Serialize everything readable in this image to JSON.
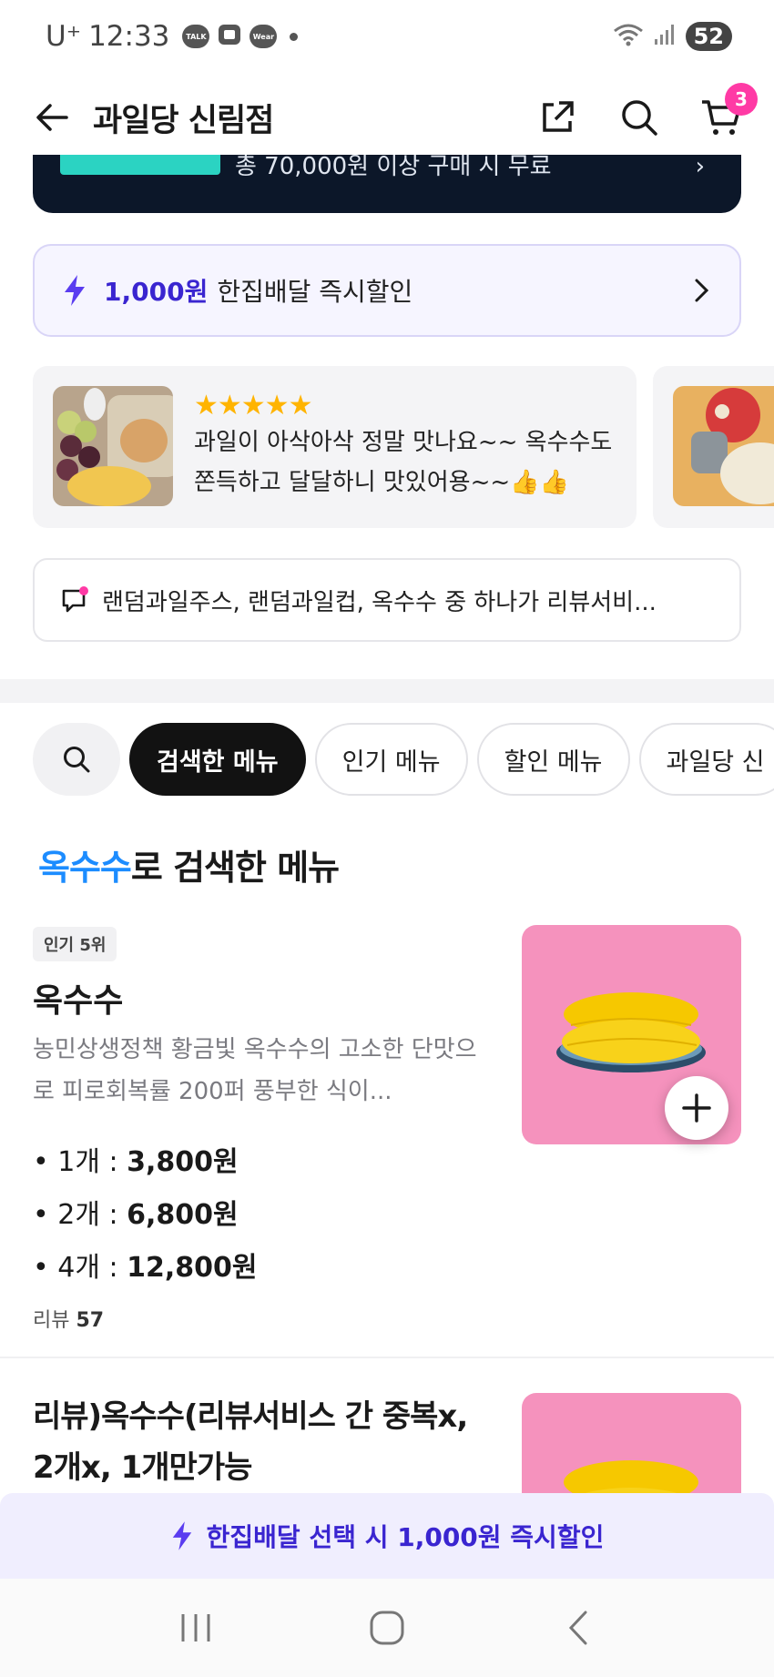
{
  "status_bar": {
    "carrier": "U⁺",
    "time": "12:33",
    "icons": [
      "talk-icon",
      "screenshot-icon",
      "wear-icon",
      "dot-icon",
      "wifi-icon",
      "signal-icon"
    ],
    "talk_label": "TALK",
    "wear_label": "Wear",
    "battery": "52"
  },
  "header": {
    "title": "과일당 신림점",
    "cart_count": "3"
  },
  "coupon_banner": {
    "text": "총 70,000원 이상 구매 시 무료"
  },
  "instant_discount": {
    "amount": "1,000원",
    "label": "한집배달 즉시할인"
  },
  "review": {
    "stars": "★★★★★",
    "text": "과일이 아삭아삭 정말 맛나요~~ 옥수수도 쫀득하고 달달하니 맛있어용~~👍👍"
  },
  "notice": {
    "text": "랜덤과일주스, 랜덤과일컵, 옥수수 중 하나가 리뷰서비..."
  },
  "chips": [
    "검색한 메뉴",
    "인기 메뉴",
    "할인 메뉴",
    "과일당 신"
  ],
  "section": {
    "keyword": "옥수수",
    "suffix": "로 검색한 메뉴"
  },
  "item1": {
    "rank": "인기 5위",
    "name": "옥수수",
    "desc": "농민상생정책 황금빛 옥수수의 고소한 단맛으로 피로회복률 200퍼 풍부한 식이...",
    "prices": [
      {
        "qty": "• 1개 : ",
        "price": "3,800원"
      },
      {
        "qty": "• 2개 : ",
        "price": "6,800원"
      },
      {
        "qty": "• 4개 : ",
        "price": "12,800원"
      }
    ],
    "review_label": "리뷰",
    "review_count": "57"
  },
  "item2": {
    "name": "리뷰)옥수수(리뷰서비스 간 중복x, 2개x, 1개만가능"
  },
  "bottom_banner": {
    "text": "한집배달 선택 시 1,000원 즉시할인"
  },
  "colors": {
    "accent_purple": "#3a25d0",
    "keyword_blue": "#1c8cff",
    "badge_pink": "#ff3aa5",
    "image_bg_pink": "#f592bd",
    "star_yellow": "#ffb400"
  }
}
